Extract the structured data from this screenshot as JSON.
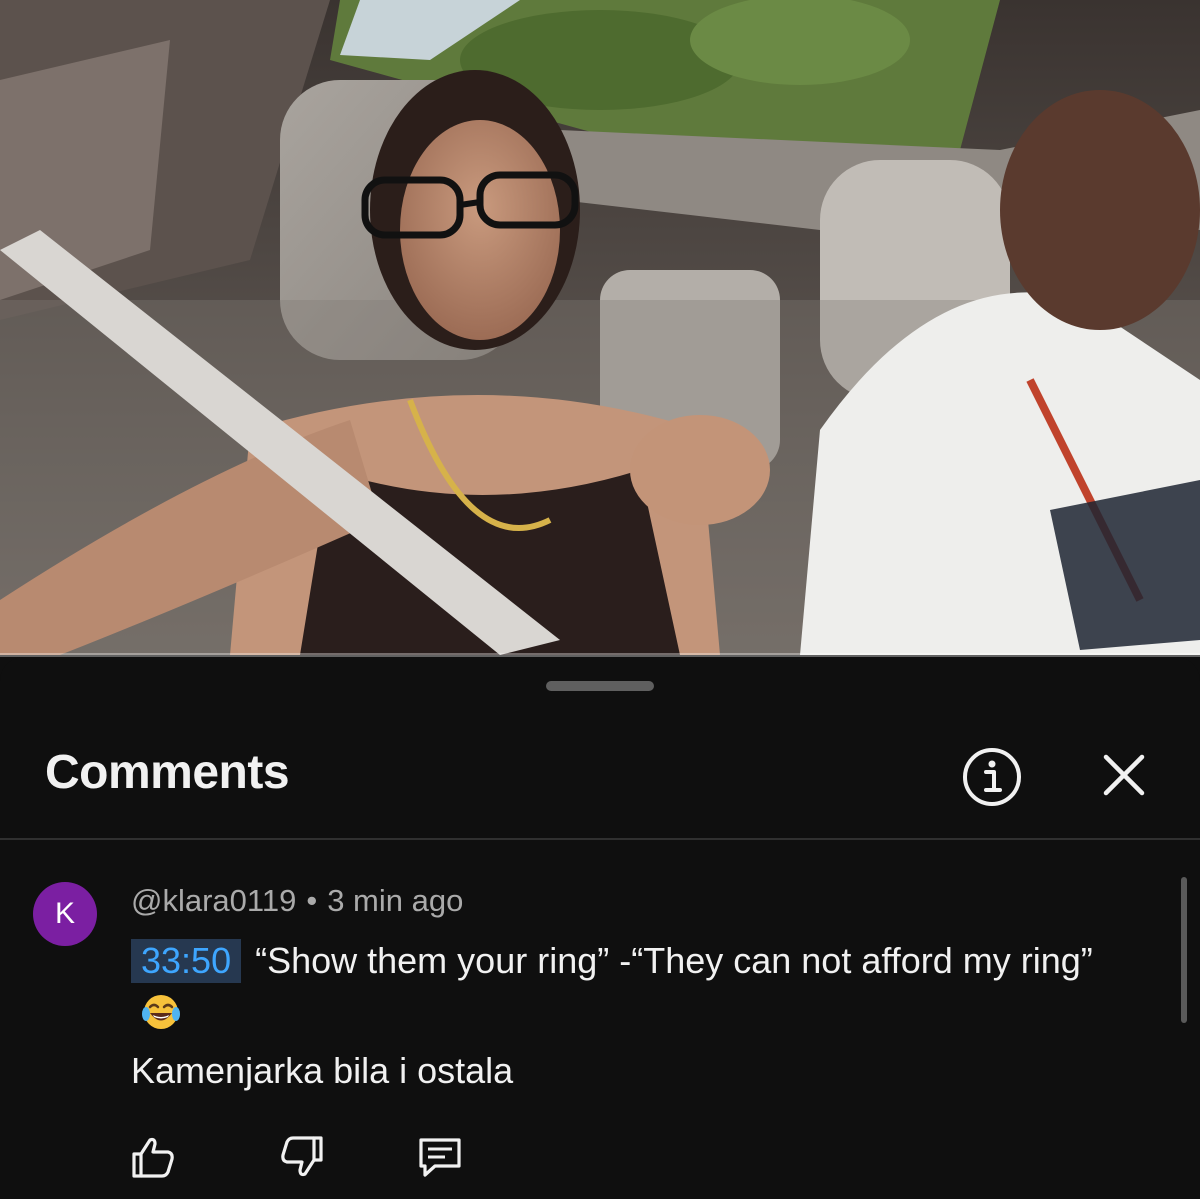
{
  "video": {
    "progress_percent": 0
  },
  "comments_panel": {
    "title": "Comments",
    "info_icon": "info-icon",
    "close_icon": "close-icon"
  },
  "comment": {
    "avatar_letter": "K",
    "avatar_color": "#7b1fa2",
    "author": "@klara0119",
    "separator": "•",
    "time_ago": "3 min ago",
    "timestamp_link": "33:50",
    "text_line1": "“Show them your ring” -“They can not afford my ring”",
    "emoji": "face-with-tears-of-joy",
    "text_line2": "Kamenjarka bila i ostala",
    "actions": {
      "like_icon": "thumbs-up-icon",
      "dislike_icon": "thumbs-down-icon",
      "reply_icon": "reply-comment-icon"
    }
  },
  "colors": {
    "link_blue": "#3ea6ff",
    "timestamp_bg": "#263850",
    "background": "#0f0f0f"
  }
}
